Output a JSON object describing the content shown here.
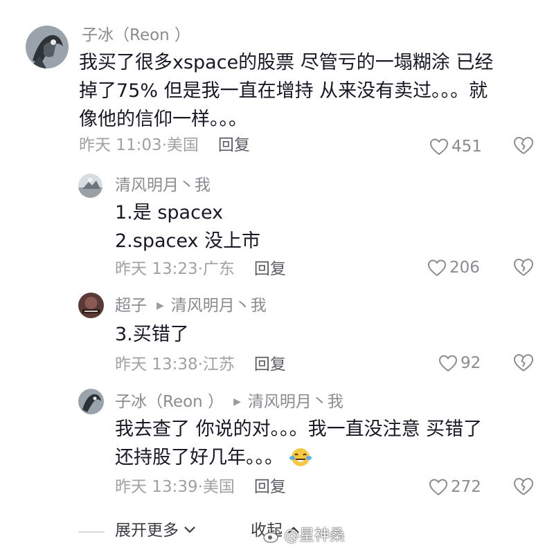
{
  "comments": [
    {
      "author": "子冰（Reon ）",
      "reply_to": "",
      "lines": [
        "我买了很多xspace的股票  尽管亏的一塌糊涂  已经",
        "掉了75%  但是我一直在增持  从来没有卖过。。。就",
        "像他的信仰一样。。。"
      ],
      "time_location": "昨天 11:03·美国",
      "reply_label": "回复",
      "likes": "451"
    },
    {
      "author": "清风明月丶我",
      "reply_to": "",
      "lines": [
        "1.是 spacex",
        "2.spacex 没上市"
      ],
      "time_location": "昨天 13:23·广东",
      "reply_label": "回复",
      "likes": "206"
    },
    {
      "author": "超子",
      "reply_to": "清风明月丶我",
      "lines": [
        "3.买错了"
      ],
      "time_location": "昨天 13:38·江苏",
      "reply_label": "回复",
      "likes": "92"
    },
    {
      "author": "子冰（Reon ）",
      "reply_to": "清风明月丶我",
      "lines": [
        "我去查了  你说的对。。。我一直没注意  买错了",
        "还持股了好几年。。。"
      ],
      "time_location": "昨天 13:39·美国",
      "reply_label": "回复",
      "likes": "272"
    }
  ],
  "footer": {
    "expand_label": "展开更多",
    "collapse_label": "收起",
    "watermark": "@星神桑"
  },
  "icons": {
    "like": "heart-outline-icon",
    "dislike": "broken-heart-icon",
    "reply_arrow": "triangle-right-icon",
    "emoji": "tears-of-joy-emoji"
  },
  "colors": {
    "text": "#161823",
    "meta": "#a0a1a6",
    "name": "#8a8b91"
  }
}
